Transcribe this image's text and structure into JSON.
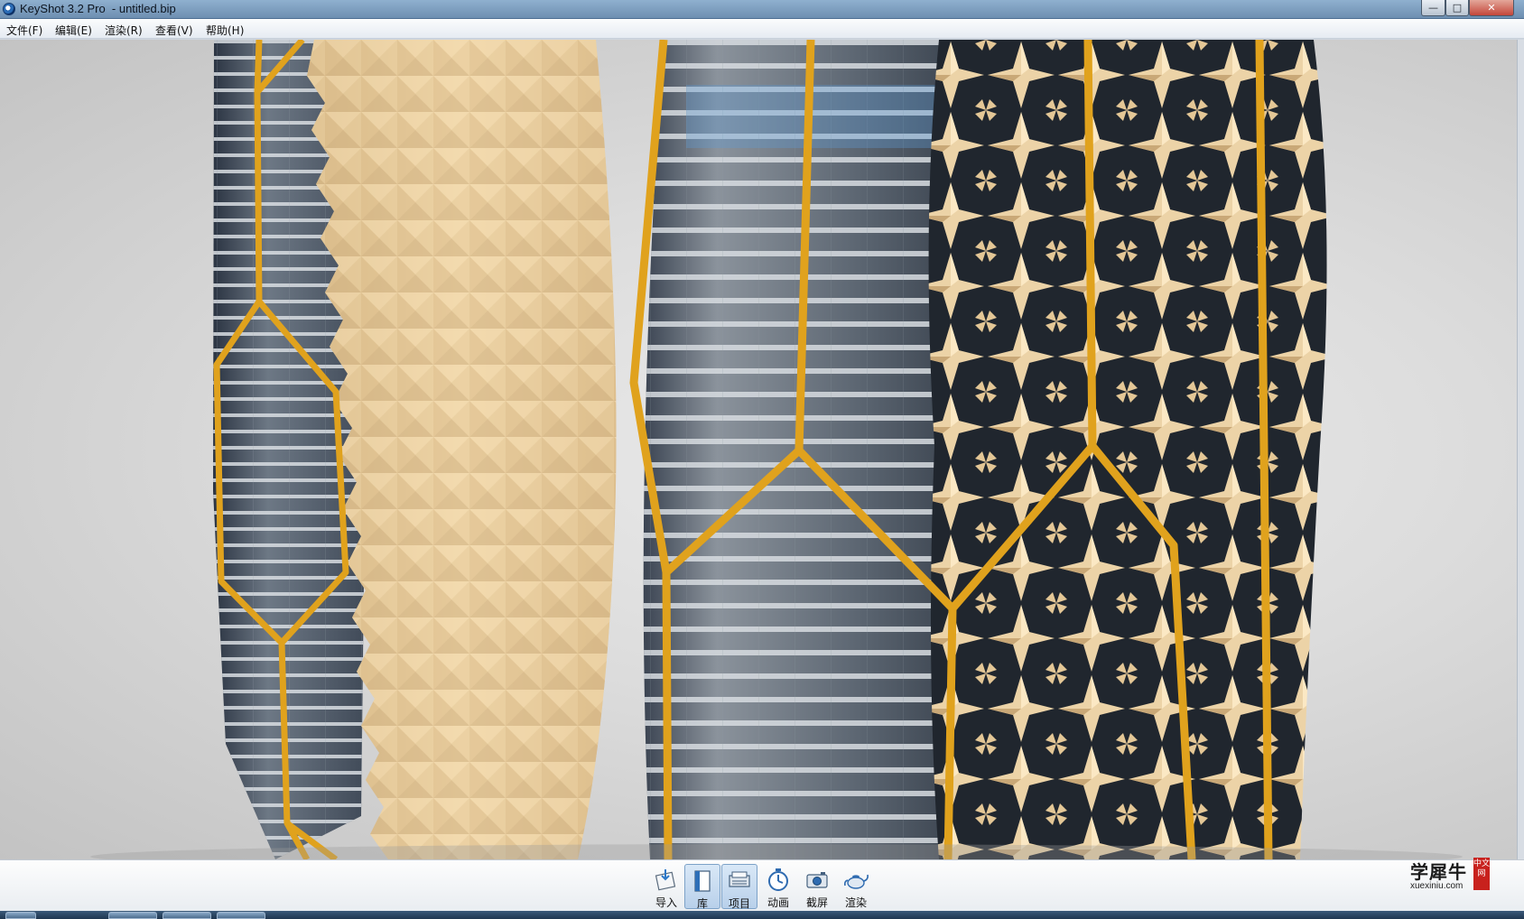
{
  "window": {
    "title": "KeyShot 3.2 Pro  - untitled.bip",
    "buttons": {
      "minimize": "—",
      "maximize": "□",
      "close": "✕"
    }
  },
  "menu": {
    "items": [
      {
        "label": "文件(F)"
      },
      {
        "label": "编辑(E)"
      },
      {
        "label": "渲染(R)"
      },
      {
        "label": "查看(V)"
      },
      {
        "label": "帮助(H)"
      }
    ]
  },
  "toolbar": {
    "tools": [
      {
        "label": "导入",
        "icon": "import-icon",
        "active": false
      },
      {
        "label": "库",
        "icon": "library-icon",
        "active": true
      },
      {
        "label": "项目",
        "icon": "project-icon",
        "active": true
      },
      {
        "label": "动画",
        "icon": "animation-icon",
        "active": false
      },
      {
        "label": "截屏",
        "icon": "screenshot-icon",
        "active": false
      },
      {
        "label": "渲染",
        "icon": "render-teapot-icon",
        "active": false
      }
    ]
  },
  "viewport": {
    "scene": "render-viewport",
    "colors": {
      "frame": "#e0a21d",
      "panel": "#ecd0a2",
      "glass": "#5f6c7a",
      "background": "#dadada"
    }
  },
  "watermark": {
    "main": "学犀牛",
    "sub": "xuexiniu.com",
    "seal": "中文网"
  }
}
